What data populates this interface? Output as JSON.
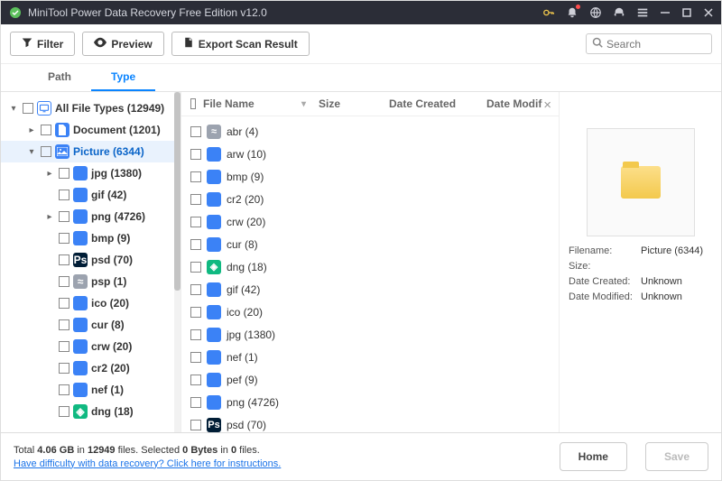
{
  "titlebar": {
    "title": "MiniTool Power Data Recovery Free Edition v12.0"
  },
  "toolbar": {
    "filter": "Filter",
    "preview": "Preview",
    "export": "Export Scan Result",
    "search_placeholder": "Search"
  },
  "tabs": {
    "path": "Path",
    "type": "Type"
  },
  "tree": {
    "root": {
      "label": "All File Types (12949)"
    },
    "document": {
      "label": "Document (1201)"
    },
    "picture": {
      "label": "Picture (6344)"
    },
    "items": [
      {
        "label": "jpg (1380)",
        "expand": true,
        "icon": "blue",
        "txt": ""
      },
      {
        "label": "gif (42)",
        "expand": false,
        "icon": "blue",
        "txt": ""
      },
      {
        "label": "png (4726)",
        "expand": true,
        "icon": "blue",
        "txt": ""
      },
      {
        "label": "bmp (9)",
        "expand": false,
        "icon": "blue",
        "txt": ""
      },
      {
        "label": "psd (70)",
        "expand": false,
        "icon": "psd",
        "txt": "Ps"
      },
      {
        "label": "psp (1)",
        "expand": false,
        "icon": "gray",
        "txt": "≈"
      },
      {
        "label": "ico (20)",
        "expand": false,
        "icon": "blue",
        "txt": ""
      },
      {
        "label": "cur (8)",
        "expand": false,
        "icon": "blue",
        "txt": ""
      },
      {
        "label": "crw (20)",
        "expand": false,
        "icon": "blue",
        "txt": ""
      },
      {
        "label": "cr2 (20)",
        "expand": false,
        "icon": "blue",
        "txt": ""
      },
      {
        "label": "nef (1)",
        "expand": false,
        "icon": "blue",
        "txt": ""
      },
      {
        "label": "dng (18)",
        "expand": false,
        "icon": "green",
        "txt": "◈"
      }
    ]
  },
  "files": {
    "headers": {
      "name": "File Name",
      "size": "Size",
      "date_created": "Date Created",
      "date_modified": "Date Modif"
    },
    "items": [
      {
        "label": "abr (4)",
        "icon": "gray",
        "txt": "≈"
      },
      {
        "label": "arw (10)",
        "icon": "blue",
        "txt": ""
      },
      {
        "label": "bmp (9)",
        "icon": "blue",
        "txt": ""
      },
      {
        "label": "cr2 (20)",
        "icon": "blue",
        "txt": ""
      },
      {
        "label": "crw (20)",
        "icon": "blue",
        "txt": ""
      },
      {
        "label": "cur (8)",
        "icon": "blue",
        "txt": ""
      },
      {
        "label": "dng (18)",
        "icon": "green",
        "txt": "◈"
      },
      {
        "label": "gif (42)",
        "icon": "blue",
        "txt": ""
      },
      {
        "label": "ico (20)",
        "icon": "blue",
        "txt": ""
      },
      {
        "label": "jpg (1380)",
        "icon": "blue",
        "txt": ""
      },
      {
        "label": "nef (1)",
        "icon": "blue",
        "txt": ""
      },
      {
        "label": "pef (9)",
        "icon": "blue",
        "txt": ""
      },
      {
        "label": "png (4726)",
        "icon": "blue",
        "txt": ""
      },
      {
        "label": "psd (70)",
        "icon": "psd",
        "txt": "Ps"
      }
    ]
  },
  "preview": {
    "filename_k": "Filename:",
    "filename_v": "Picture (6344)",
    "size_k": "Size:",
    "size_v": "",
    "dc_k": "Date Created:",
    "dc_v": "Unknown",
    "dm_k": "Date Modified:",
    "dm_v": "Unknown"
  },
  "status": {
    "line1_a": "Total ",
    "line1_b": "4.06 GB",
    "line1_c": " in ",
    "line1_d": "12949",
    "line1_e": " files.   Selected ",
    "line1_f": "0 Bytes",
    "line1_g": " in ",
    "line1_h": "0",
    "line1_i": " files.",
    "help": "Have difficulty with data recovery? Click here for instructions.",
    "home": "Home",
    "save": "Save"
  }
}
